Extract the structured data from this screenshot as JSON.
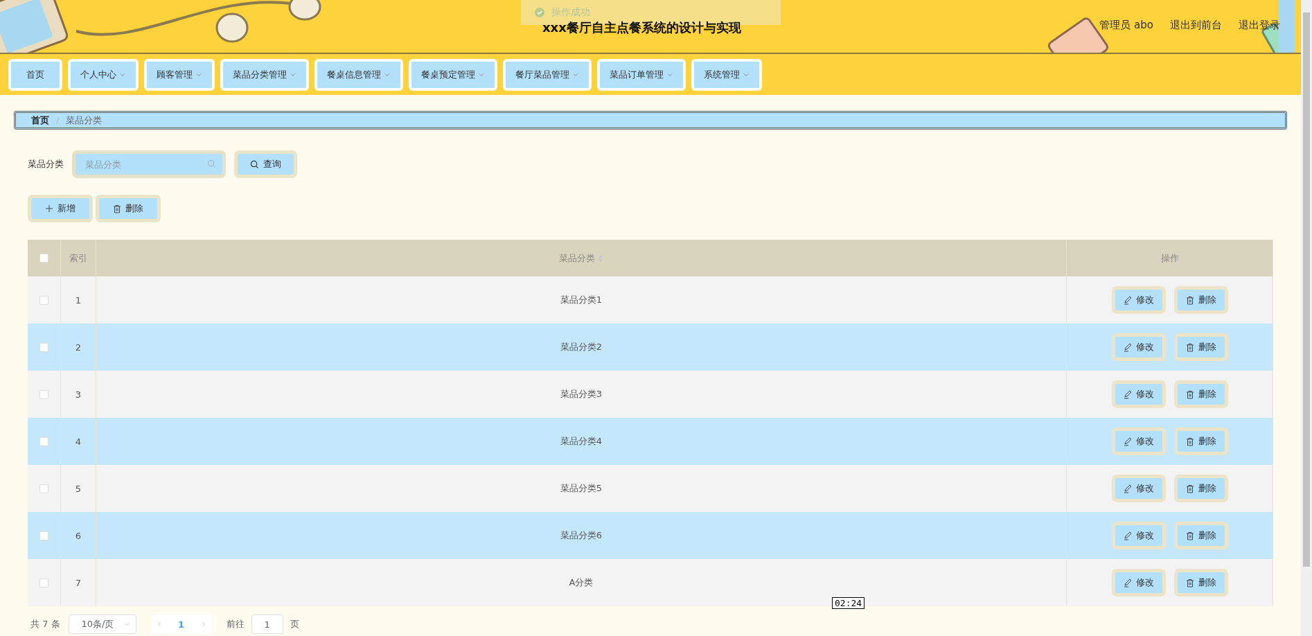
{
  "header": {
    "title": "xxx餐厅自主点餐系统的设计与实现",
    "toast": "操作成功",
    "user_links": [
      "管理员 abo",
      "退出到前台",
      "退出登录"
    ]
  },
  "nav": [
    {
      "label": "首页",
      "kind": "link"
    },
    {
      "label": "个人中心",
      "kind": "dropdown"
    },
    {
      "label": "顾客管理",
      "kind": "dropdown"
    },
    {
      "label": "菜品分类管理",
      "kind": "dropdown"
    },
    {
      "label": "餐桌信息管理",
      "kind": "dropdown"
    },
    {
      "label": "餐桌预定管理",
      "kind": "dropdown"
    },
    {
      "label": "餐厅菜品管理",
      "kind": "dropdown"
    },
    {
      "label": "菜品订单管理",
      "kind": "dropdown"
    },
    {
      "label": "系统管理",
      "kind": "dropdown"
    }
  ],
  "breadcrumb": {
    "items": [
      "首页",
      "菜品分类"
    ],
    "separator": "/"
  },
  "search": {
    "label": "菜品分类",
    "placeholder": "菜品分类",
    "button": "查询"
  },
  "actions": [
    "新增",
    "删除"
  ],
  "table": {
    "columns": [
      "索引",
      "菜品分类",
      "操作"
    ],
    "all_checked": false,
    "rows": [
      {
        "index": "1",
        "name": "菜品分类1",
        "checked": false,
        "actions": [
          "修改",
          "删除"
        ]
      },
      {
        "index": "2",
        "name": "菜品分类2",
        "checked": false,
        "actions": [
          "修改",
          "删除"
        ]
      },
      {
        "index": "3",
        "name": "菜品分类3",
        "checked": false,
        "actions": [
          "修改",
          "删除"
        ]
      },
      {
        "index": "4",
        "name": "菜品分类4",
        "checked": false,
        "actions": [
          "修改",
          "删除"
        ]
      },
      {
        "index": "5",
        "name": "菜品分类5",
        "checked": false,
        "actions": [
          "修改",
          "删除"
        ]
      },
      {
        "index": "6",
        "name": "菜品分类6",
        "checked": false,
        "actions": [
          "修改",
          "删除"
        ]
      },
      {
        "index": "7",
        "name": "A分类",
        "checked": false,
        "actions": [
          "修改",
          "删除"
        ]
      }
    ]
  },
  "pagination": {
    "total": "共 7 条",
    "page_size": "10条/页",
    "pages": [
      {
        "label": "1",
        "selected": true
      }
    ],
    "goto_label": "前往",
    "goto_value": "1",
    "goto_suffix": "页"
  },
  "timestamp": "02:24"
}
